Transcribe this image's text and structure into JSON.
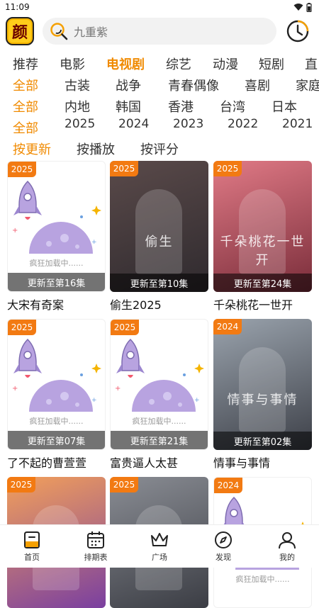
{
  "status": {
    "time": "11:09"
  },
  "logo": {
    "char": "颜"
  },
  "search": {
    "placeholder": "九重紫"
  },
  "categories": [
    "推荐",
    "电影",
    "电视剧",
    "综艺",
    "动漫",
    "短剧",
    "直"
  ],
  "genres": [
    "全部",
    "古装",
    "战争",
    "青春偶像",
    "喜剧",
    "家庭"
  ],
  "regions": [
    "全部",
    "内地",
    "韩国",
    "香港",
    "台湾",
    "日本"
  ],
  "years": [
    "全部",
    "2025",
    "2024",
    "2023",
    "2022",
    "2021"
  ],
  "sorts": [
    "按更新",
    "按播放",
    "按评分"
  ],
  "loading_text": "疯狂加载中......",
  "cards": [
    {
      "year": "2025",
      "episode": "更新至第16集",
      "title": "大宋有奇案",
      "poster": "loading"
    },
    {
      "year": "2025",
      "episode": "更新至第10集",
      "title": "偷生2025",
      "poster": "art",
      "art_text": "偷生",
      "colors": [
        "#5a4a4a",
        "#2f2a2e"
      ]
    },
    {
      "year": "2025",
      "episode": "更新至第24集",
      "title": "千朵桃花一世开",
      "poster": "art",
      "art_text": "千朵桃花一世开",
      "colors": [
        "#e07a86",
        "#7a2d3a"
      ]
    },
    {
      "year": "2025",
      "episode": "更新至第07集",
      "title": "了不起的曹萱萱",
      "poster": "loading"
    },
    {
      "year": "2025",
      "episode": "更新至第21集",
      "title": "富贵逼人太甚",
      "poster": "loading"
    },
    {
      "year": "2024",
      "episode": "更新至第02集",
      "title": "情事与事情",
      "poster": "art",
      "art_text": "情事与事情",
      "colors": [
        "#9aa3ad",
        "#3d4048"
      ]
    },
    {
      "year": "2025",
      "episode": "",
      "title": "",
      "poster": "art",
      "art_text": "",
      "colors": [
        "#f3a05a",
        "#7a3fa0"
      ]
    },
    {
      "year": "2025",
      "episode": "",
      "title": "",
      "poster": "art",
      "art_text": "",
      "colors": [
        "#8a8d94",
        "#3b3d44"
      ]
    },
    {
      "year": "2024",
      "episode": "",
      "title": "",
      "poster": "loading"
    }
  ],
  "nav": [
    {
      "label": "首页",
      "icon": "home-icon",
      "active": true
    },
    {
      "label": "排期表",
      "icon": "calendar-icon",
      "active": false
    },
    {
      "label": "广场",
      "icon": "crown-icon",
      "active": false
    },
    {
      "label": "发现",
      "icon": "compass-icon",
      "active": false
    },
    {
      "label": "我的",
      "icon": "user-icon",
      "active": false
    }
  ],
  "colors": {
    "accent": "#f08a00",
    "badge": "#f27a12"
  }
}
